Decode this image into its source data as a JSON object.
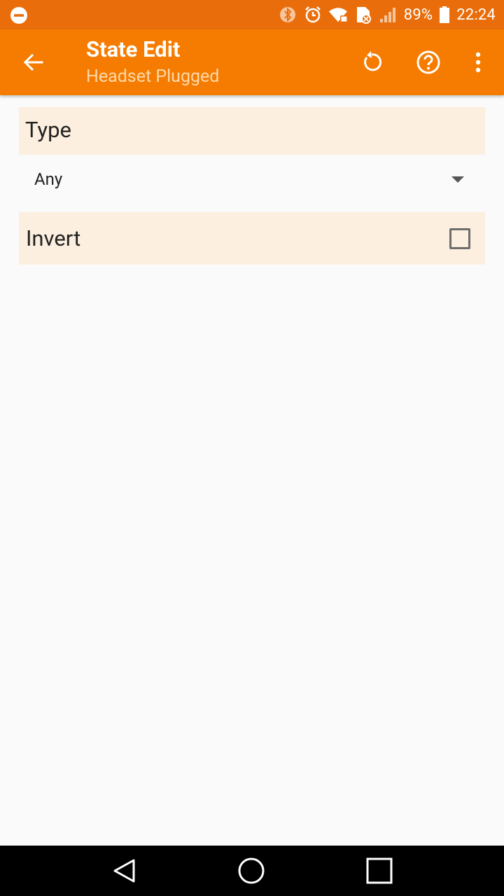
{
  "status_bar": {
    "battery_percent": "89%",
    "time": "22:24",
    "icons": [
      "dnd-icon",
      "bluetooth-icon",
      "alarm-icon",
      "wifi-icon",
      "sim-icon",
      "signal-icon",
      "battery-icon"
    ]
  },
  "app_bar": {
    "title": "State Edit",
    "subtitle": "Headset Plugged",
    "actions": [
      "back-arrow-icon",
      "reset-icon",
      "help-icon",
      "overflow-menu-icon"
    ]
  },
  "content": {
    "type_header": "Type",
    "type_value": "Any",
    "invert_label": "Invert",
    "invert_checked": false
  },
  "nav_bar": {
    "buttons": [
      "nav-back-icon",
      "nav-home-icon",
      "nav-recents-icon"
    ]
  },
  "colors": {
    "status_bar": "#e96e0b",
    "app_bar": "#f57c00",
    "section_bg": "#fdefdf",
    "page_bg": "#fafafa"
  }
}
